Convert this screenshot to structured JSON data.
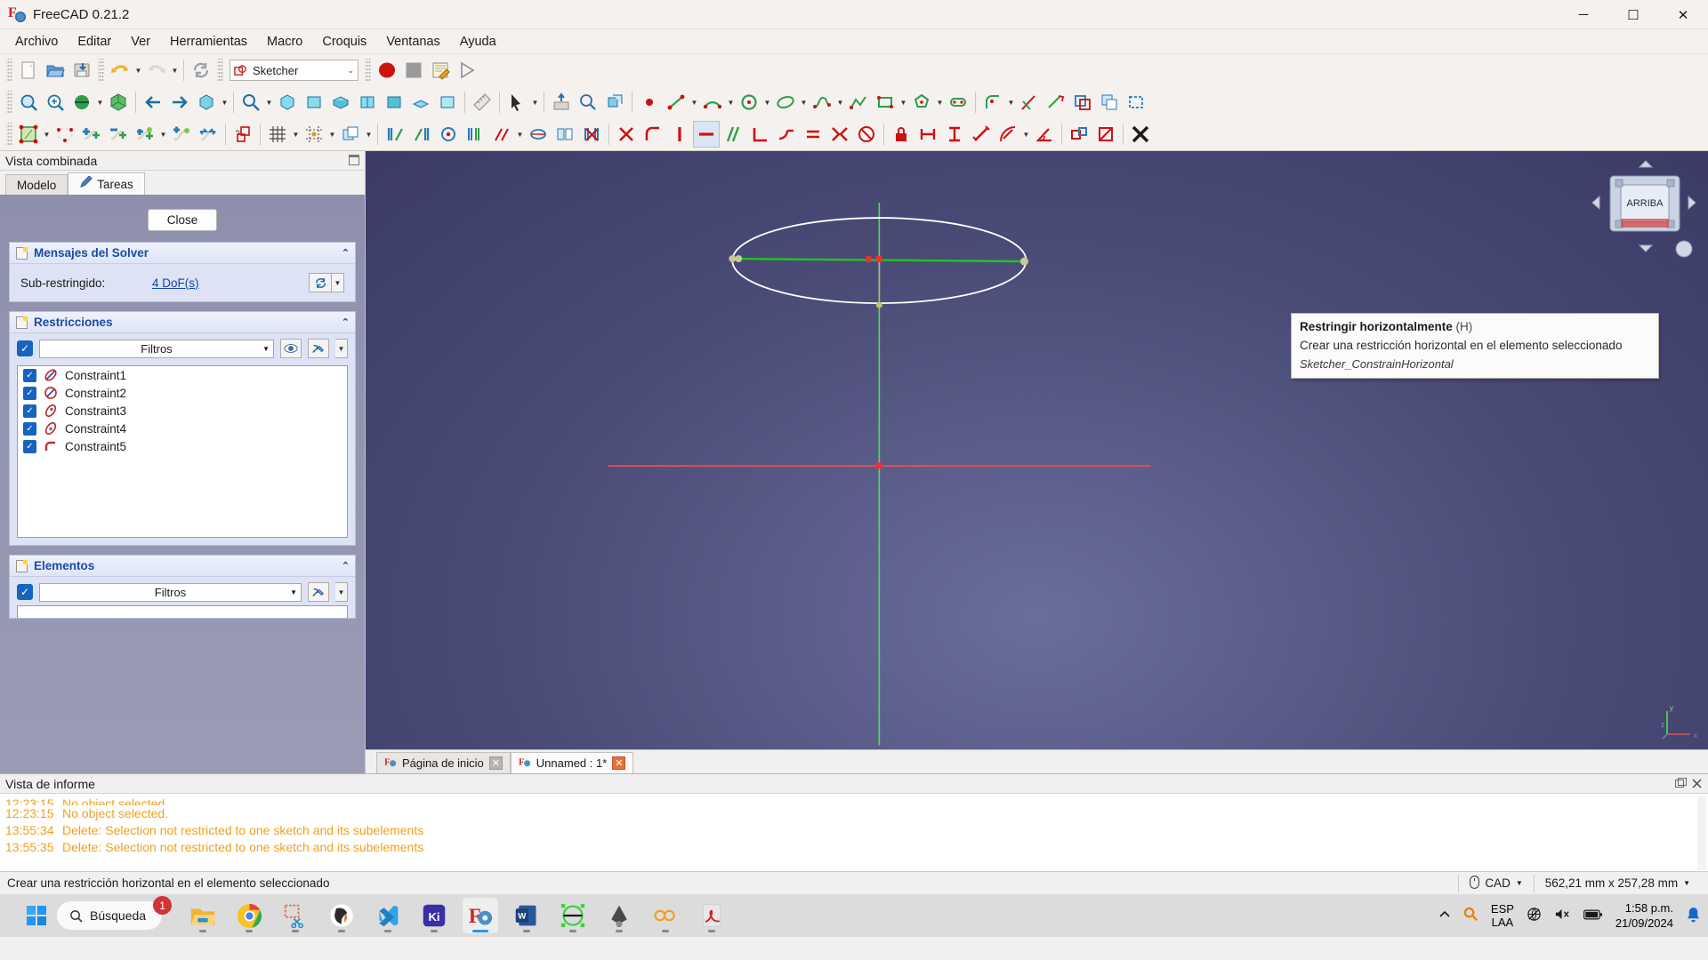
{
  "window": {
    "title": "FreeCAD 0.21.2",
    "icon": "freecad-icon",
    "minimize": "─",
    "maximize": "☐",
    "close": "✕"
  },
  "menu": {
    "items": [
      "Archivo",
      "Editar",
      "Ver",
      "Herramientas",
      "Macro",
      "Croquis",
      "Ventanas",
      "Ayuda"
    ]
  },
  "toolbar": {
    "workbench_selected": "Sketcher"
  },
  "combined_view": {
    "title": "Vista combinada",
    "tabs": [
      {
        "label": "Modelo",
        "active": false
      },
      {
        "label": "Tareas",
        "active": true
      }
    ],
    "close_button": "Close",
    "solver": {
      "title": "Mensajes del Solver",
      "label": "Sub-restringido:",
      "value": "4 DoF(s)"
    },
    "constraints": {
      "title": "Restricciones",
      "filter_placeholder": "Filtros",
      "items": [
        {
          "label": "Constraint1",
          "icon": "constraint-parallel-icon"
        },
        {
          "label": "Constraint2",
          "icon": "constraint-perpendicular-icon"
        },
        {
          "label": "Constraint3",
          "icon": "constraint-point-on-object-icon"
        },
        {
          "label": "Constraint4",
          "icon": "constraint-point-on-object-icon"
        },
        {
          "label": "Constraint5",
          "icon": "constraint-tangent-icon"
        }
      ]
    },
    "elements": {
      "title": "Elementos",
      "filter_placeholder": "Filtros"
    }
  },
  "tooltip": {
    "title": "Restringir horizontalmente",
    "shortcut": "(H)",
    "description": "Crear una restricción horizontal en el elemento seleccionado",
    "command": "Sketcher_ConstrainHorizontal"
  },
  "viewport": {
    "nav_cube_face": "ARRIBA",
    "axis_x": "x",
    "axis_y": "y",
    "axis_z": "z"
  },
  "document_tabs": [
    {
      "label": "Página de inicio",
      "active": false,
      "close": "✕"
    },
    {
      "label": "Unnamed : 1*",
      "active": true,
      "close": "✕"
    }
  ],
  "report_view": {
    "title": "Vista de informe",
    "lines": [
      {
        "time": "12:23:15",
        "text": "No object selected."
      },
      {
        "time": "12:23:15",
        "text": "No object selected."
      },
      {
        "time": "13:55:34",
        "text": "Delete: Selection not restricted to one sketch and its subelements"
      },
      {
        "time": "13:55:35",
        "text": "Delete: Selection not restricted to one sketch and its subelements"
      }
    ],
    "color": "#f0a020"
  },
  "status_bar": {
    "message": "Crear una restricción horizontal en el elemento seleccionado",
    "nav_style": "CAD",
    "dimensions": "562,21 mm x 257,28 mm"
  },
  "taskbar": {
    "search_placeholder": "Búsqueda",
    "search_badge": "1",
    "apps": [
      {
        "name": "file-explorer"
      },
      {
        "name": "google-chrome"
      },
      {
        "name": "snipping-tool"
      },
      {
        "name": "obsidian"
      },
      {
        "name": "vs-code"
      },
      {
        "name": "kicad"
      },
      {
        "name": "freecad",
        "active": true
      },
      {
        "name": "microsoft-word"
      },
      {
        "name": "fusion360"
      },
      {
        "name": "inkscape"
      },
      {
        "name": "openscad"
      },
      {
        "name": "adobe-reader"
      }
    ],
    "tray": {
      "language_top": "ESP",
      "language_bottom": "LAA",
      "time": "1:58 p.m.",
      "date": "21/09/2024"
    }
  }
}
